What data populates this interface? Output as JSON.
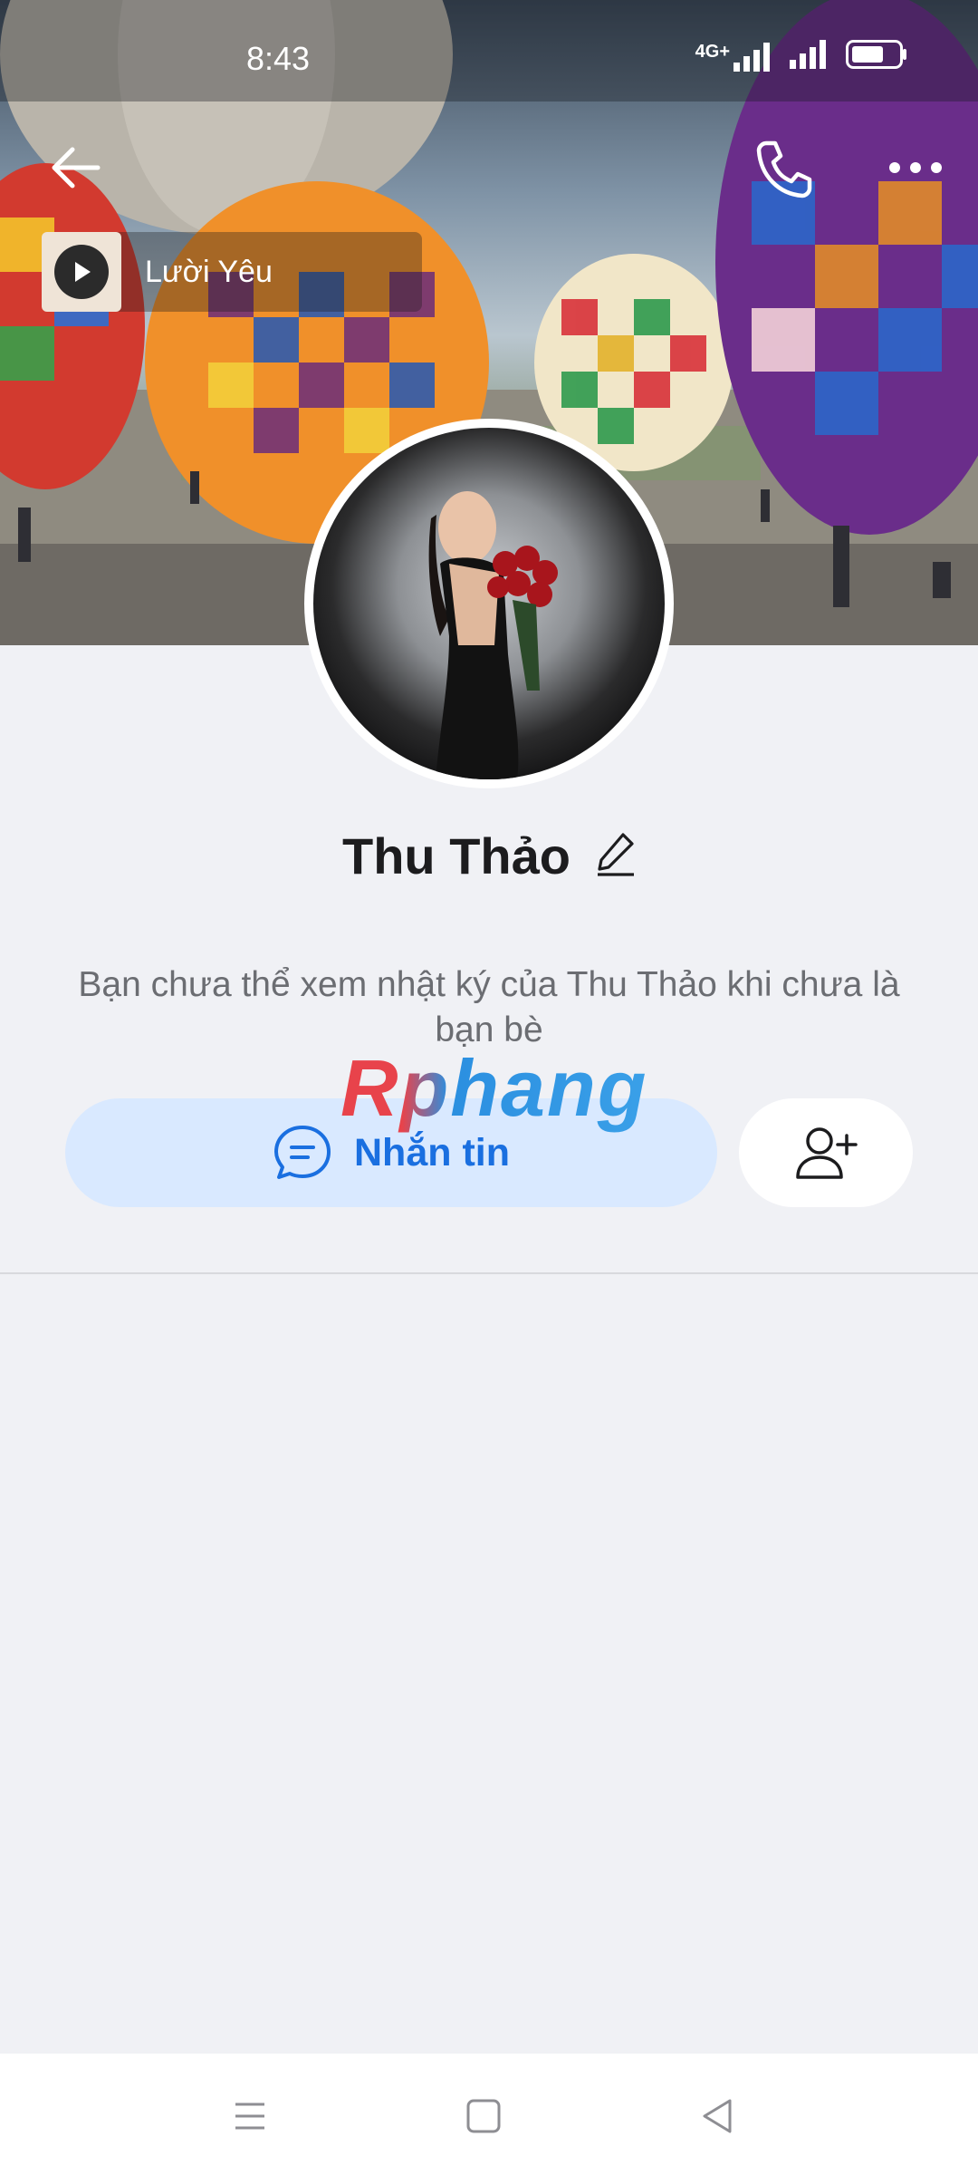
{
  "status_bar": {
    "time": "8:43",
    "network": "4G+",
    "icons": [
      "signal-4g-icon",
      "signal-icon",
      "battery-icon"
    ]
  },
  "header": {
    "icons": [
      "back-arrow-icon",
      "phone-icon",
      "more-icon"
    ]
  },
  "music": {
    "title": "Lười Yêu",
    "icon": "play-icon"
  },
  "profile": {
    "name": "Thu Thảo",
    "edit_icon": "pencil-icon"
  },
  "notice": "Bạn chưa thể xem nhật ký của Thu Thảo khi chưa là bạn bè",
  "watermark": "Rphang",
  "actions": {
    "message_label": "Nhắn tin",
    "message_icon": "chat-bubble-icon",
    "add_friend_icon": "add-user-icon"
  },
  "colors": {
    "accent": "#1a6fe0",
    "message_button_bg": "#d9e9ff",
    "page_bg": "#f0f1f5"
  },
  "navbar": {
    "icons": [
      "menu-icon",
      "home-icon",
      "back-icon"
    ]
  }
}
